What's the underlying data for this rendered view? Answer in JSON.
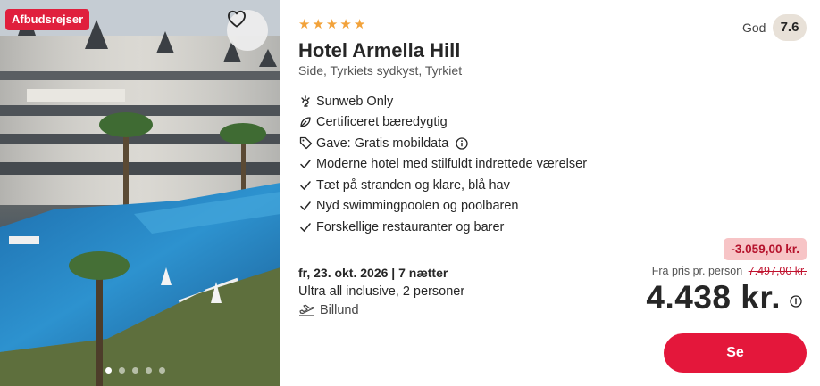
{
  "photo": {
    "badge": "Afbudsrejser",
    "favorite_icon": "heart-icon",
    "carousel_dots": 5,
    "active_dot": 0
  },
  "hotel": {
    "stars": 5,
    "name": "Hotel Armella Hill",
    "location": "Side, Tyrkiets sydkyst, Tyrkiet",
    "rating_label": "God",
    "rating_score": "7.6"
  },
  "badges": [
    {
      "icon": "sunweb-icon",
      "label": "Sunweb Only"
    },
    {
      "icon": "leaf-icon",
      "label": "Certificeret bæredygtig"
    },
    {
      "icon": "tag-icon",
      "label": "Gave: Gratis mobildata"
    }
  ],
  "highlights": [
    "Moderne hotel med stilfuldt indrettede værelser",
    "Tæt på stranden og klare, blå hav",
    "Nyd swimmingpoolen og poolbaren",
    "Forskellige restauranter og barer"
  ],
  "trip": {
    "date": "fr, 23. okt. 2026 | 7 nætter",
    "board": "Ultra all inclusive, 2 personer",
    "airport": "Billund"
  },
  "price": {
    "discount": "-3.059,00 kr.",
    "from_label": "Fra pris pr. person",
    "old_price": "7.497,00 kr.",
    "current": "4.438 kr.",
    "button": "Se"
  },
  "colors": {
    "accent": "#e4173b",
    "star": "#f2a23a",
    "discount_bg": "#f7c4c6",
    "rating_bg": "#e8e1d8"
  }
}
